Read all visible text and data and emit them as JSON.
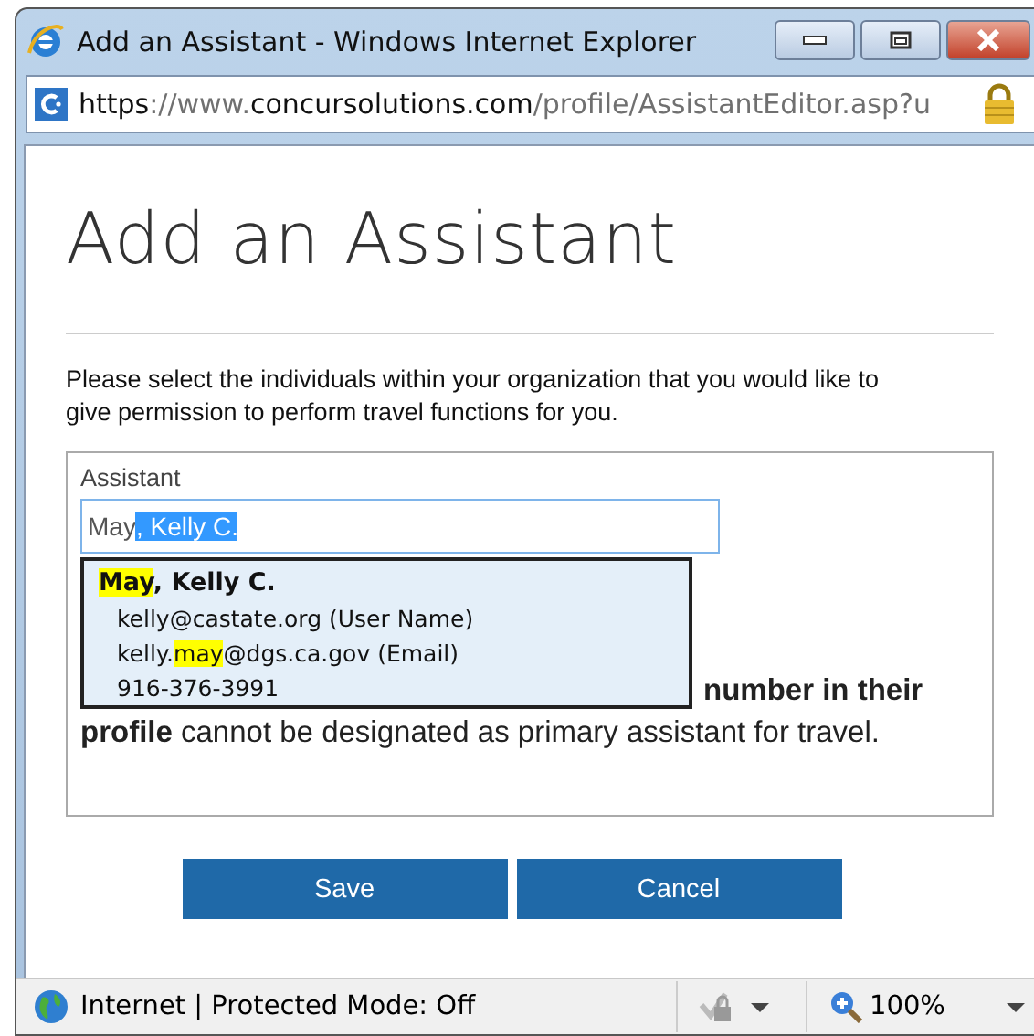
{
  "window": {
    "title": "Add an Assistant - Windows Internet Explorer"
  },
  "address_bar": {
    "url": [
      {
        "text": "https",
        "emphasis": true
      },
      {
        "text": "://www.",
        "emphasis": false
      },
      {
        "text": "concursolutions.com",
        "emphasis": true
      },
      {
        "text": "/profile/AssistantEditor.asp?u",
        "emphasis": false
      }
    ]
  },
  "page": {
    "heading": "Add an Assistant",
    "intro": "Please select the individuals within your organization that you would like to give permission to perform travel functions for you.",
    "assistant_field": {
      "label": "Assistant",
      "typed": "May",
      "autocompleted": ", Kelly C."
    },
    "suggestion": {
      "lines": [
        {
          "kind": "name",
          "segments": [
            {
              "text": "May",
              "highlight": true
            },
            {
              "text": ", Kelly C.",
              "highlight": false
            }
          ]
        },
        {
          "kind": "detail",
          "segments": [
            {
              "text": "kelly@castate.org (User Name)",
              "highlight": false
            }
          ]
        },
        {
          "kind": "detail",
          "segments": [
            {
              "text": "kelly.",
              "highlight": false
            },
            {
              "text": "may",
              "highlight": true
            },
            {
              "text": "@dgs.ca.gov (Email)",
              "highlight": false
            }
          ]
        },
        {
          "kind": "detail",
          "segments": [
            {
              "text": "916-376-3991",
              "highlight": false
            }
          ]
        }
      ]
    },
    "note": {
      "first_line": "number in their",
      "rest": "**profile** cannot be designated as primary assistant for travel."
    },
    "buttons": [
      "Save",
      "Cancel"
    ]
  },
  "status_bar": {
    "zone": "Internet | Protected Mode: Off",
    "zoom": "100%"
  }
}
